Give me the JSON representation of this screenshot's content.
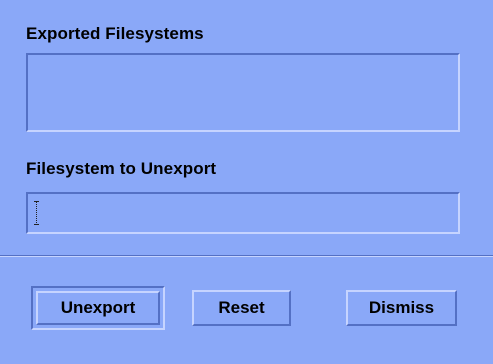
{
  "dialog": {
    "exported_label": "Exported Filesystems",
    "exported_items": [],
    "unexport_label": "Filesystem to Unexport",
    "unexport_value": ""
  },
  "buttons": {
    "unexport": "Unexport",
    "reset": "Reset",
    "dismiss": "Dismiss"
  },
  "colors": {
    "background": "#8aa8f8",
    "shadow": "#5470c4",
    "highlight": "#c6d4ff"
  }
}
